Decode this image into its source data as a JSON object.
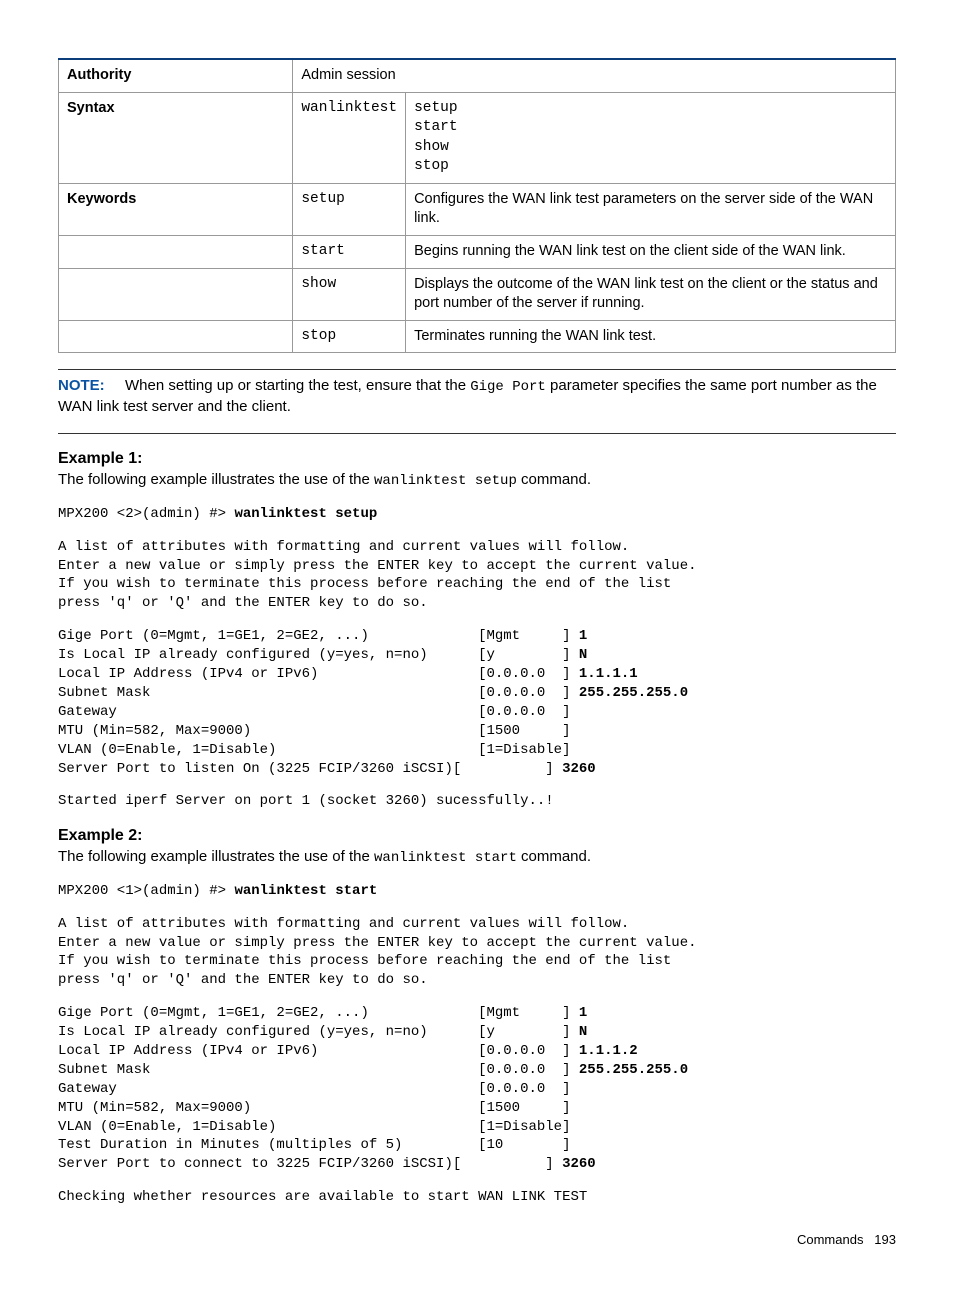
{
  "table": {
    "rows": [
      {
        "label": "Authority",
        "c2": "Admin session",
        "c3": "",
        "span12": true,
        "mono2": false
      },
      {
        "label": "Syntax",
        "c2": "wanlinktest",
        "c3": "setup\nstart\nshow\nstop",
        "mono2": true,
        "mono3": true
      },
      {
        "label": "Keywords",
        "c2": "setup",
        "c3": "Configures the WAN link test parameters on the server side of the WAN link.",
        "mono2": true
      },
      {
        "label": "",
        "c2": "start",
        "c3": "Begins running the WAN link test on the client side of the WAN link.",
        "mono2": true
      },
      {
        "label": "",
        "c2": "show",
        "c3": "Displays the outcome of the WAN link test on the client or the status and port number of the server if running.",
        "mono2": true
      },
      {
        "label": "",
        "c2": "stop",
        "c3": "Terminates running the WAN link test.",
        "mono2": true
      }
    ]
  },
  "note": {
    "label": "NOTE:",
    "before": "When setting up or starting the test, ensure that the ",
    "code": "Gige Port",
    "after": " parameter specifies the same port number as the WAN link test server and the client."
  },
  "ex1": {
    "head": "Example 1:",
    "intro_before": "The following example illustrates the use of the ",
    "intro_code": "wanlinktest setup",
    "intro_after": " command.",
    "prompt": "MPX200 <2>(admin) #> ",
    "cmd": "wanlinktest setup",
    "para": "A list of attributes with formatting and current values will follow.\nEnter a new value or simply press the ENTER key to accept the current value.\nIf you wish to terminate this process before reaching the end of the list\npress 'q' or 'Q' and the ENTER key to do so.",
    "lines": [
      {
        "t": "Gige Port (0=Mgmt, 1=GE1, 2=GE2, ...)             [Mgmt     ] ",
        "b": "1"
      },
      {
        "t": "Is Local IP already configured (y=yes, n=no)      [y        ] ",
        "b": "N"
      },
      {
        "t": "Local IP Address (IPv4 or IPv6)                   [0.0.0.0  ] ",
        "b": "1.1.1.1"
      },
      {
        "t": "Subnet Mask                                       [0.0.0.0  ] ",
        "b": "255.255.255.0"
      },
      {
        "t": "Gateway                                           [0.0.0.0  ]",
        "b": ""
      },
      {
        "t": "MTU (Min=582, Max=9000)                           [1500     ]",
        "b": ""
      },
      {
        "t": "VLAN (0=Enable, 1=Disable)                        [1=Disable]",
        "b": ""
      },
      {
        "t": "Server Port to listen On (3225 FCIP/3260 iSCSI)[          ] ",
        "b": "3260"
      }
    ],
    "tail": "Started iperf Server on port 1 (socket 3260) sucessfully..!"
  },
  "ex2": {
    "head": "Example 2:",
    "intro_before": "The following example illustrates the use of the ",
    "intro_code": "wanlinktest start",
    "intro_after": " command.",
    "prompt": "MPX200 <1>(admin) #> ",
    "cmd": "wanlinktest start",
    "para": "A list of attributes with formatting and current values will follow.\nEnter a new value or simply press the ENTER key to accept the current value.\nIf you wish to terminate this process before reaching the end of the list\npress 'q' or 'Q' and the ENTER key to do so.",
    "lines": [
      {
        "t": "Gige Port (0=Mgmt, 1=GE1, 2=GE2, ...)             [Mgmt     ] ",
        "b": "1"
      },
      {
        "t": "Is Local IP already configured (y=yes, n=no)      [y        ] ",
        "b": "N"
      },
      {
        "t": "Local IP Address (IPv4 or IPv6)                   [0.0.0.0  ] ",
        "b": "1.1.1.2"
      },
      {
        "t": "Subnet Mask                                       [0.0.0.0  ] ",
        "b": "255.255.255.0"
      },
      {
        "t": "Gateway                                           [0.0.0.0  ]",
        "b": ""
      },
      {
        "t": "MTU (Min=582, Max=9000)                           [1500     ]",
        "b": ""
      },
      {
        "t": "VLAN (0=Enable, 1=Disable)                        [1=Disable]",
        "b": ""
      },
      {
        "t": "Test Duration in Minutes (multiples of 5)         [10       ]",
        "b": ""
      },
      {
        "t": "Server Port to connect to 3225 FCIP/3260 iSCSI)[          ] ",
        "b": "3260"
      }
    ],
    "tail": "Checking whether resources are available to start WAN LINK TEST"
  },
  "footer": {
    "label": "Commands",
    "page": "193"
  }
}
